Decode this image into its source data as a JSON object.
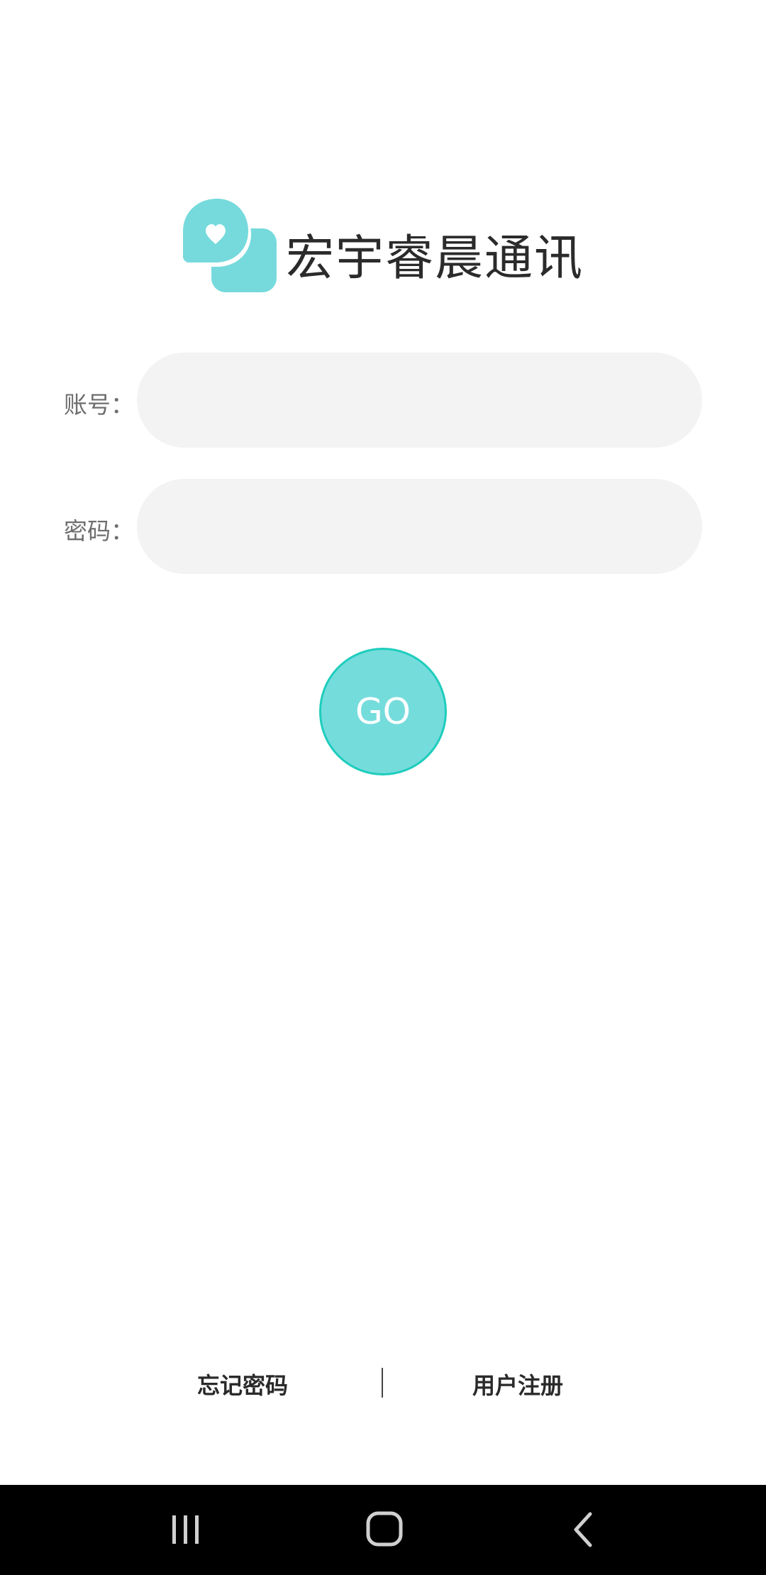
{
  "app": {
    "title": "宏宇睿晨通讯",
    "logo_icon": "chat-bubbles-heart-icon",
    "accent_color": "#75dcdc"
  },
  "form": {
    "account_label": "账号：",
    "account_value": "",
    "password_label": "密码：",
    "password_value": "",
    "submit_label": "GO"
  },
  "links": {
    "forgot_password": "忘记密码",
    "register": "用户注册"
  },
  "navbar": {
    "recent_icon": "recent-apps-icon",
    "home_icon": "home-icon",
    "back_icon": "back-icon"
  }
}
